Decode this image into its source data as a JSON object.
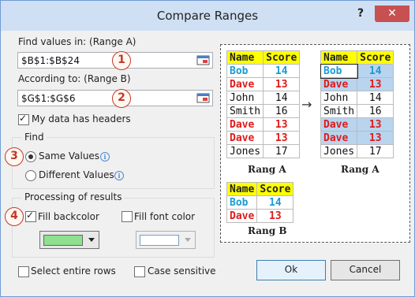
{
  "window": {
    "title": "Compare Ranges",
    "help_label": "?",
    "close_label": "✕"
  },
  "range_a": {
    "label": "Find values in: (Range A)",
    "value": "$B$1:$B$24",
    "marker": "1"
  },
  "range_b": {
    "label": "According to: (Range B)",
    "value": "$G$1:$G$6",
    "marker": "2"
  },
  "headers": {
    "label": "My data has headers",
    "checked": true
  },
  "find": {
    "legend": "Find",
    "marker": "3",
    "options": [
      {
        "label": "Same Values",
        "selected": true
      },
      {
        "label": "Different Values",
        "selected": false
      }
    ]
  },
  "processing": {
    "legend": "Processing of results",
    "marker": "4",
    "fill_backcolor": {
      "label": "Fill backcolor",
      "checked": true,
      "color": "#8fe08f"
    },
    "fill_font_color": {
      "label": "Fill font color",
      "checked": false,
      "color": "#ffffff"
    }
  },
  "select_entire_rows": {
    "label": "Select entire rows",
    "checked": false
  },
  "case_sensitive": {
    "label": "Case sensitive",
    "checked": false
  },
  "buttons": {
    "ok": "Ok",
    "cancel": "Cancel"
  },
  "preview": {
    "range_a_before": {
      "caption": "Rang A",
      "header": [
        "Name",
        "Score"
      ],
      "rows": [
        [
          "Bob",
          "14"
        ],
        [
          "Dave",
          "13"
        ],
        [
          "John",
          "14"
        ],
        [
          "Smith",
          "16"
        ],
        [
          "Dave",
          "13"
        ],
        [
          "Dave",
          "13"
        ],
        [
          "Jones",
          "17"
        ]
      ]
    },
    "range_a_after": {
      "caption": "Rang A",
      "header": [
        "Name",
        "Score"
      ],
      "rows": [
        [
          "Bob",
          "14"
        ],
        [
          "Dave",
          "13"
        ],
        [
          "John",
          "14"
        ],
        [
          "Smith",
          "16"
        ],
        [
          "Dave",
          "13"
        ],
        [
          "Dave",
          "13"
        ],
        [
          "Jones",
          "17"
        ]
      ]
    },
    "range_b": {
      "caption": "Rang B",
      "header": [
        "Name",
        "Score"
      ],
      "rows": [
        [
          "Bob",
          "14"
        ],
        [
          "Dave",
          "13"
        ]
      ]
    },
    "arrow": "→"
  },
  "colors": {
    "header_bg": "#ffff00",
    "bob_color": "#1a9bd7",
    "dave_color": "#e01a1a",
    "highlight": "#b8d4ef",
    "normal_text": "#111111"
  }
}
